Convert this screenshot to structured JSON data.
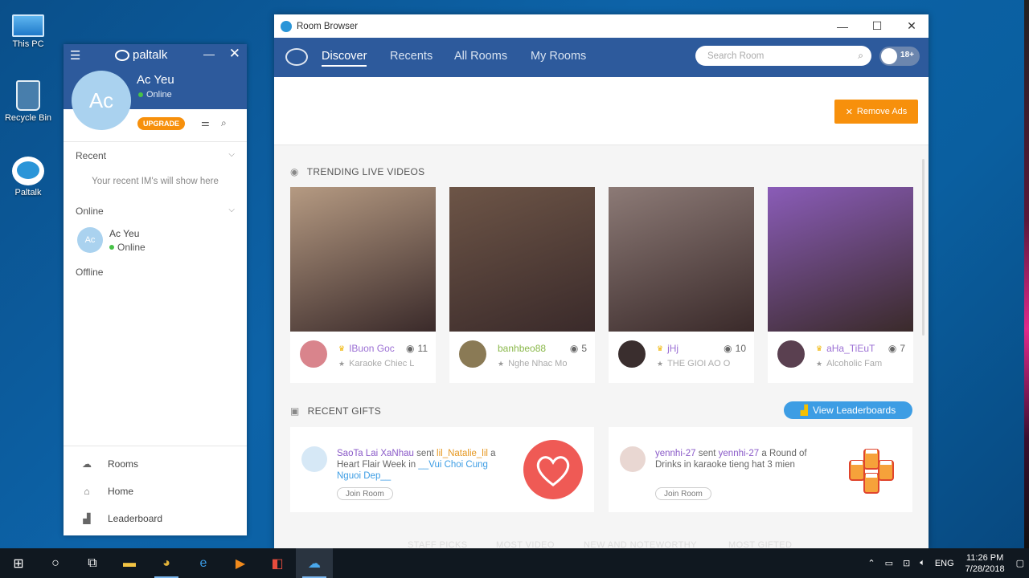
{
  "desktop": {
    "icons": [
      {
        "label": "This PC"
      },
      {
        "label": "Recycle Bin"
      },
      {
        "label": "Paltalk"
      }
    ]
  },
  "paltalk": {
    "logo_text": "paltalk",
    "user": {
      "initials": "Ac",
      "name": "Ac Yeu",
      "status": "Online"
    },
    "upgrade_label": "UPGRADE",
    "sections": {
      "recent": "Recent",
      "recent_empty": "Your recent IM's will show here",
      "online": "Online",
      "offline": "Offline"
    },
    "contact": {
      "initials": "Ac",
      "name": "Ac Yeu",
      "status": "Online"
    },
    "nav": [
      {
        "label": "Rooms",
        "icon": "rooms-icon"
      },
      {
        "label": "Home",
        "icon": "home-icon"
      },
      {
        "label": "Leaderboard",
        "icon": "leaderboard-icon"
      }
    ]
  },
  "room_browser": {
    "title": "Room Browser",
    "tabs": [
      "Discover",
      "Recents",
      "All Rooms",
      "My Rooms"
    ],
    "active_tab": "Discover",
    "search_placeholder": "Search Room",
    "adult_toggle_label": "18+",
    "remove_ads_label": "Remove Ads",
    "trending_title": "TRENDING LIVE VIDEOS",
    "cards": [
      {
        "user": "IBuon Goc",
        "viewers": "11",
        "room": "Karaoke Chiec L",
        "name_color": "#9b6fd4",
        "crown": true,
        "thumb": "#b59a82",
        "avatar": "#d9848c"
      },
      {
        "user": "banhbeo88",
        "viewers": "5",
        "room": "Nghe Nhac Mo",
        "name_color": "#8ab84a",
        "crown": false,
        "thumb": "#6d5547",
        "avatar": "#8a7a55"
      },
      {
        "user": "jHj",
        "viewers": "10",
        "room": "THE GIOI AO O",
        "name_color": "#9b6fd4",
        "crown": true,
        "thumb": "#8c7a76",
        "avatar": "#3a2e2e"
      },
      {
        "user": "aHa_TiEuT",
        "viewers": "7",
        "room": "Alcoholic Fam",
        "name_color": "#9b6fd4",
        "crown": true,
        "thumb": "#8a5cb8",
        "avatar": "#5a4050"
      }
    ],
    "gifts_title": "RECENT GIFTS",
    "leaderboard_label": "View Leaderboards",
    "gifts": [
      {
        "from": "SaoTa Lai XaNhau",
        "verb": " sent ",
        "to": "lil_Natalie_lil",
        "mid": " a Heart Flair Week in ",
        "room": "__Vui Choi Cung Nguoi Dep__",
        "end": "",
        "join": "Join Room",
        "img_color": "#ef5a55"
      },
      {
        "from": "yennhi-27",
        "verb": " sent ",
        "to": "yennhi-27",
        "mid": " a Round of Drinks in karaoke tieng hat 3 mien",
        "room": "",
        "end": "",
        "join": "Join Room",
        "img_color": "#f6a23a"
      }
    ],
    "bottom_tabs": [
      "STAFF PICKS",
      "MOST VIDEO",
      "NEW AND NOTEWORTHY",
      "MOST GIFTED"
    ]
  },
  "taskbar": {
    "language": "ENG",
    "time": "11:26 PM",
    "date": "7/28/2018"
  }
}
